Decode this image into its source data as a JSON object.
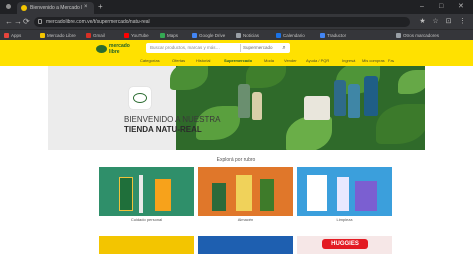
{
  "browser": {
    "tab_title": "Bienvenido a Mercado Libre",
    "tab_close": "×",
    "new_tab": "+",
    "url": "mercadolibre.com.ve/t/supermercado/natu-real",
    "window_controls": [
      "–",
      "□",
      "✕"
    ],
    "nav": {
      "back": "←",
      "forward": "→",
      "reload": "⟳"
    },
    "toolbar_icons": [
      "★",
      "☆",
      "⊡",
      "⋮"
    ]
  },
  "bookmarks": [
    {
      "label": "Apps",
      "color": "#e8453c"
    },
    {
      "label": "Mercado Libre",
      "color": "#f3c500"
    },
    {
      "label": "Gmail",
      "color": "#d93025"
    },
    {
      "label": "YouTube",
      "color": "#ff0000"
    },
    {
      "label": "Maps",
      "color": "#34a853"
    },
    {
      "label": "Google Drive",
      "color": "#4285f4"
    },
    {
      "label": "Noticias",
      "color": "#9aa0a6"
    },
    {
      "label": "Calendario",
      "color": "#1a73e8"
    },
    {
      "label": "Traductor",
      "color": "#4285f4"
    },
    {
      "label": "Otros marcadores",
      "color": "#9aa0a6"
    }
  ],
  "site": {
    "logo_line1": "mercado",
    "logo_line2": "libre",
    "search_placeholder": "Buscar productos, marcas y más…",
    "search_category": "Supermercado",
    "search_icon": "⌕",
    "subnav": [
      "Categorías",
      "Ofertas",
      "Historial",
      "Supermercado",
      "Moda",
      "Vender",
      "Ayuda / PQR",
      "Ingresá",
      "Mis compras",
      "Favoritos"
    ]
  },
  "hero": {
    "line1": "BIENVENIDO A NUESTRA",
    "line2": "TIENDA NATU-REAL"
  },
  "explore": {
    "title": "Explorá por rubro",
    "categories": [
      {
        "label": "Cuidado personal",
        "bg": "#2f8f6a"
      },
      {
        "label": "Almacén",
        "bg": "#e0772a"
      },
      {
        "label": "Limpieza",
        "bg": "#3b9fdc"
      }
    ],
    "row2": [
      {
        "bg": "#f3c500"
      },
      {
        "bg": "#1e5fb0"
      },
      {
        "bg": "#f6e7e7",
        "badge": "HUGGIES"
      }
    ]
  },
  "colors": {
    "brand_yellow": "#ffe100",
    "browser_dark": "#202124",
    "browser_mid": "#35363a"
  }
}
